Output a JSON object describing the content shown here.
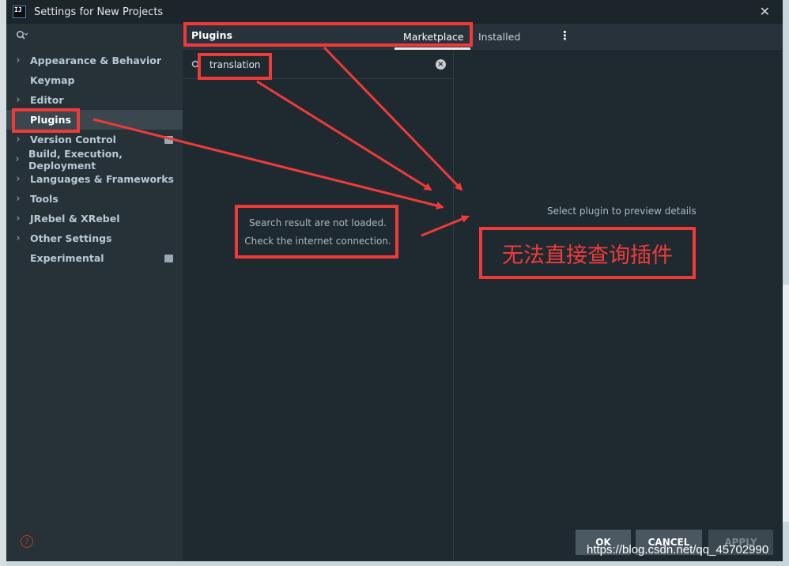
{
  "window": {
    "title": "Settings for New Projects",
    "icon_text": "IJ"
  },
  "sidebar": {
    "items": [
      {
        "label": "Appearance & Behavior",
        "expandable": true
      },
      {
        "label": "Keymap",
        "expandable": false
      },
      {
        "label": "Editor",
        "expandable": true
      },
      {
        "label": "Plugins",
        "expandable": false,
        "selected": true
      },
      {
        "label": "Version Control",
        "expandable": true,
        "badge": true
      },
      {
        "label": "Build, Execution, Deployment",
        "expandable": true
      },
      {
        "label": "Languages & Frameworks",
        "expandable": true
      },
      {
        "label": "Tools",
        "expandable": true
      },
      {
        "label": "JRebel & XRebel",
        "expandable": true
      },
      {
        "label": "Other Settings",
        "expandable": true
      },
      {
        "label": "Experimental",
        "expandable": false,
        "badge": true
      }
    ]
  },
  "plugins": {
    "title": "Plugins",
    "tabs": {
      "marketplace": "Marketplace",
      "installed": "Installed"
    },
    "search_value": "translation",
    "message_line1": "Search result are not loaded.",
    "message_line2": "Check the internet connection.",
    "preview": "Select plugin to preview details"
  },
  "buttons": {
    "ok": "OK",
    "cancel": "CANCEL",
    "apply": "APPLY"
  },
  "annotation": {
    "text": "无法直接查询插件",
    "color": "#f03a3a"
  },
  "watermark": "https://blog.csdn.net/qq_45702990",
  "colors": {
    "window_bg": "#1f2a30",
    "sidebar_bg": "#263238",
    "selected_bg": "#3b474e",
    "accent": "#f03a3a"
  }
}
